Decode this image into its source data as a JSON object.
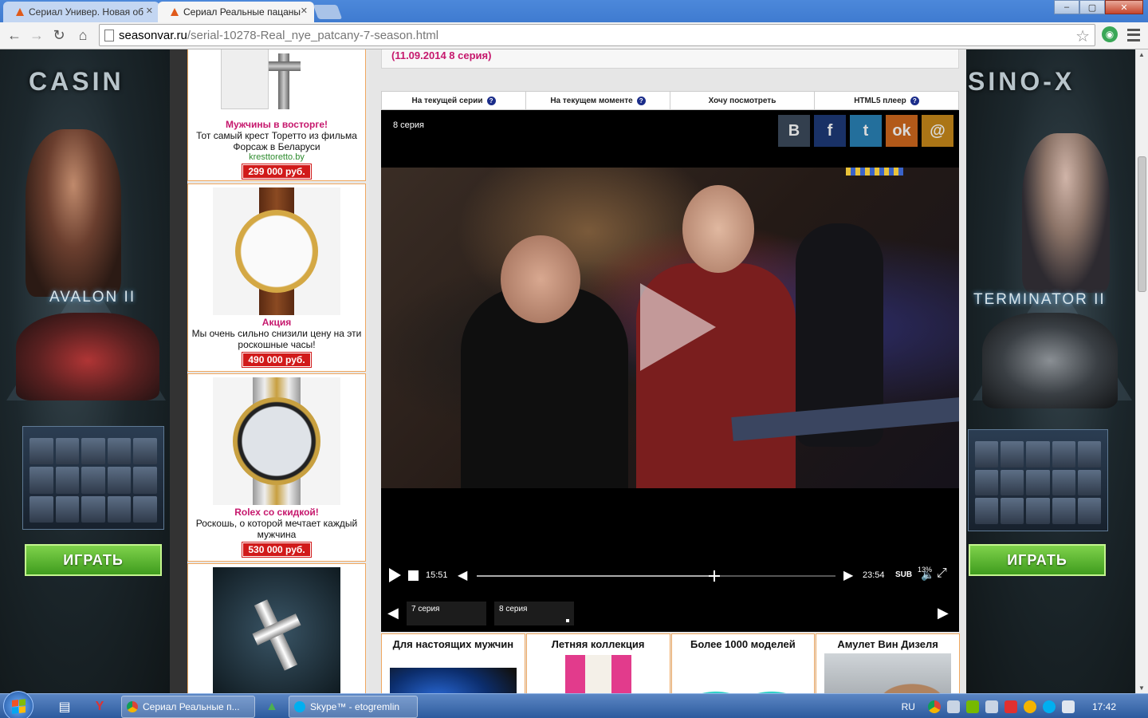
{
  "browser": {
    "tabs": [
      {
        "title": "Сериал Универ. Новая об",
        "active": false
      },
      {
        "title": "Сериал Реальные пацаны",
        "active": true
      }
    ],
    "url_host": "seasonvar.ru",
    "url_path": "/serial-10278-Real_nye_patcany-7-season.html",
    "window_controls": {
      "minimize": "–",
      "maximize": "▢",
      "close": "✕"
    }
  },
  "banners": {
    "left": {
      "brand": "CASIN",
      "game": "AVALON II",
      "cta": "ИГРАТЬ"
    },
    "right": {
      "brand": "SINO-X",
      "game": "TERMINATOR II",
      "cta": "ИГРАТЬ"
    }
  },
  "ads": [
    {
      "title": "Мужчины в восторге!",
      "desc": "Тот самый крест Торетто из фильма Форсаж в Беларуси",
      "link": "kresttoretto.by",
      "price": "299 000 руб."
    },
    {
      "title": "Акция",
      "desc": "Мы очень сильно снизили цену на эти роскошные часы!",
      "link": "",
      "price": "490 000 руб."
    },
    {
      "title": "Rolex со скидкой!",
      "desc": "Роскошь, о которой мечтает каждый мужчина",
      "link": "",
      "price": "530 000 руб."
    }
  ],
  "episode_note": "(11.09.2014 8 серия)",
  "player": {
    "tabs": [
      "На текущей серии",
      "На текущем моменте",
      "Хочу посмотреть",
      "HTML5 плеер"
    ],
    "tab_help": [
      "?",
      "?",
      "",
      "?"
    ],
    "current_episode": "8 серия",
    "share": [
      {
        "label": "В",
        "color": "#3c4a5c"
      },
      {
        "label": "f",
        "color": "#1e3a78"
      },
      {
        "label": "t",
        "color": "#2a83b8"
      },
      {
        "label": "ok",
        "color": "#d2691e"
      },
      {
        "label": "@",
        "color": "#c98a1a"
      }
    ],
    "time_elapsed": "15:51",
    "time_total": "23:54",
    "progress_percent": 66,
    "buffer_label": "13%",
    "sub_label": "SUB",
    "episodes": [
      "7 серия",
      "8 серия"
    ]
  },
  "products": [
    {
      "title": "Для настоящих мужчин"
    },
    {
      "title": "Летняя коллекция"
    },
    {
      "title": "Более 1000 моделей"
    },
    {
      "title": "Амулет Вин Дизеля"
    }
  ],
  "taskbar": {
    "tasks": [
      {
        "label": "Сериал Реальные п..."
      },
      {
        "label": "Skype™ - etogremlin"
      }
    ],
    "lang": "RU",
    "clock": "17:42"
  }
}
